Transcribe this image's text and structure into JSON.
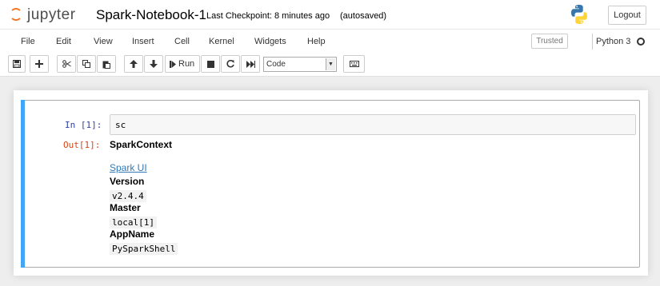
{
  "header": {
    "logo_text": "jupyter",
    "notebook_name": "Spark-Notebook-1",
    "checkpoint": "Last Checkpoint: 8 minutes ago",
    "autosave": "(autosaved)",
    "logout_label": "Logout"
  },
  "menubar": {
    "items": [
      "File",
      "Edit",
      "View",
      "Insert",
      "Cell",
      "Kernel",
      "Widgets",
      "Help"
    ],
    "trusted_label": "Trusted",
    "kernel_name": "Python 3"
  },
  "toolbar": {
    "run_label": "Run",
    "cell_type": "Code"
  },
  "cell": {
    "in_prompt": "In [1]:",
    "input_code": "sc",
    "out_prompt": "Out[1]:",
    "output": {
      "title": "SparkContext",
      "link": "Spark UI",
      "version_label": "Version",
      "version_value": "v2.4.4",
      "master_label": "Master",
      "master_value": "local[1]",
      "appname_label": "AppName",
      "appname_value": "PySparkShell"
    }
  },
  "colors": {
    "jupyter_orange": "#f37726",
    "cell_selected_bar": "#42a5f5",
    "in_prompt": "#303f9f",
    "out_prompt": "#d84315",
    "link": "#337ab7"
  }
}
